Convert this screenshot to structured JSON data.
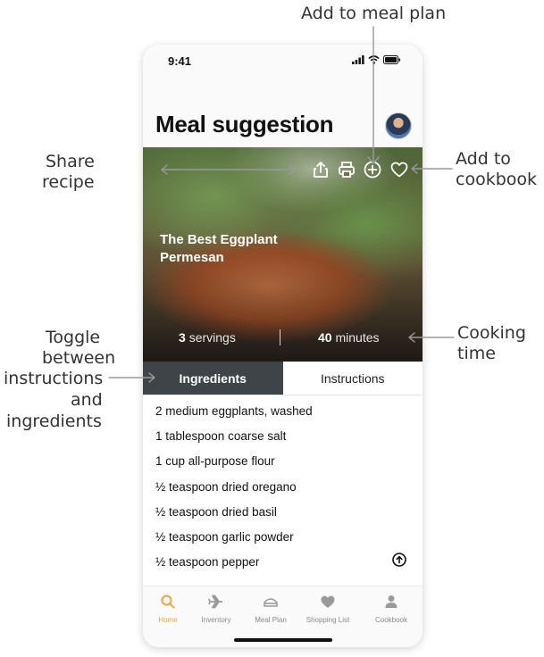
{
  "annotations": {
    "add_to_meal_plan": "Add to meal plan",
    "share_recipe_1": "Share",
    "share_recipe_2": "recipe",
    "add_to_cookbook_1": "Add to",
    "add_to_cookbook_2": "cookbook",
    "toggle_1": "Toggle",
    "toggle_2": "between",
    "toggle_3": "instructions",
    "toggle_4": "and",
    "toggle_5": "ingredients",
    "cooking_time_1": "Cooking",
    "cooking_time_2": "time"
  },
  "status_bar": {
    "time": "9:41"
  },
  "header": {
    "title": "Meal suggestion"
  },
  "recipe": {
    "title_line1": "The Best Eggplant",
    "title_line2": "Permesan",
    "servings_value": "3",
    "servings_unit": "servings",
    "minutes_value": "40",
    "minutes_unit": "minutes"
  },
  "tabs": {
    "ingredients": "Ingredients",
    "instructions": "Instructions",
    "active": "ingredients"
  },
  "ingredients": [
    "2 medium eggplants, washed",
    "1 tablespoon coarse salt",
    "1 cup all-purpose flour",
    "½ teaspoon dried oregano",
    "½ teaspoon dried basil",
    "½ teaspoon garlic powder",
    "½ teaspoon pepper"
  ],
  "tabbar": {
    "items": [
      {
        "label": "Home",
        "icon": "search-icon",
        "active": true
      },
      {
        "label": "Inventory",
        "icon": "plane-icon",
        "active": false
      },
      {
        "label": "Meal Plan",
        "icon": "meal-plan-icon",
        "active": false
      },
      {
        "label": "Shopping List",
        "icon": "heart-icon",
        "active": false
      },
      {
        "label": "Cookbook",
        "icon": "person-icon",
        "active": false
      }
    ]
  },
  "colors": {
    "accent": "#f4a13a",
    "active_tab": "#3f4449",
    "annotation_line": "#999999"
  }
}
